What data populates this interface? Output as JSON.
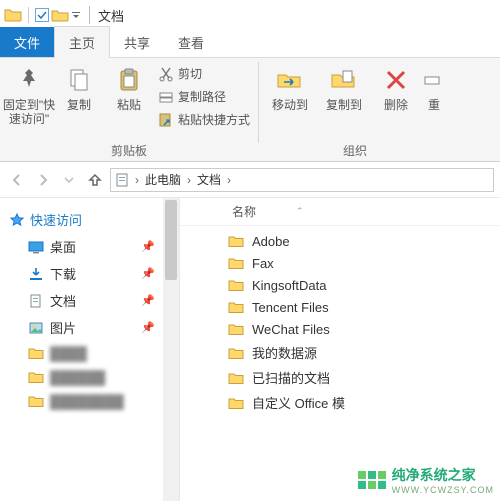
{
  "window": {
    "title": "文档"
  },
  "tabs": {
    "file": "文件",
    "home": "主页",
    "share": "共享",
    "view": "查看"
  },
  "ribbon": {
    "pin": {
      "label": "固定到\"快\n速访问\""
    },
    "copy": "复制",
    "paste": "粘贴",
    "cut": "剪切",
    "copypath": "复制路径",
    "pasteshortcut": "粘贴快捷方式",
    "group_clipboard": "剪贴板",
    "moveto": "移动到",
    "copyto": "复制到",
    "delete": "删除",
    "rename": "重",
    "group_organize": "组织"
  },
  "breadcrumb": {
    "pc": "此电脑",
    "docs": "文档"
  },
  "nav": {
    "quickaccess": "快速访问",
    "items": [
      {
        "label": "桌面"
      },
      {
        "label": "下载"
      },
      {
        "label": "文档"
      },
      {
        "label": "图片"
      },
      {
        "label": "████"
      },
      {
        "label": "██████"
      },
      {
        "label": "████████"
      }
    ]
  },
  "columns": {
    "name": "名称"
  },
  "files": [
    {
      "name": "Adobe"
    },
    {
      "name": "Fax"
    },
    {
      "name": "KingsoftData"
    },
    {
      "name": "Tencent Files"
    },
    {
      "name": "WeChat Files"
    },
    {
      "name": "我的数据源"
    },
    {
      "name": "已扫描的文档"
    },
    {
      "name": "自定义 Office 模"
    }
  ],
  "watermark": {
    "text": "纯净系统之家",
    "sub": "WWW.YCWZSY.COM"
  }
}
